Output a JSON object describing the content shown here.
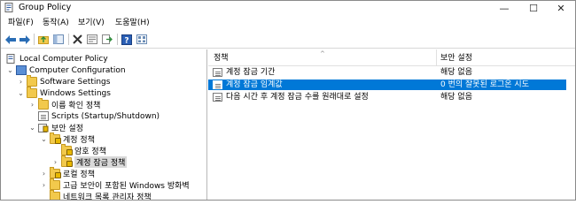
{
  "window": {
    "title": "Group Policy",
    "controls": {
      "minimize": "—",
      "maximize": "☐",
      "close": "✕"
    }
  },
  "menu": [
    "파일(F)",
    "동작(A)",
    "보기(V)",
    "도움말(H)"
  ],
  "toolbar": {
    "icons": [
      "back-arrow-icon",
      "forward-arrow-icon",
      "up-folder-icon",
      "show-hide-tree-icon",
      "delete-icon",
      "properties-icon",
      "export-list-icon",
      "help-icon",
      "view-icon"
    ]
  },
  "tree": {
    "nodes": [
      {
        "label": "Local Computer Policy",
        "icon": "policy-icon",
        "expander": ""
      },
      {
        "label": "Computer Configuration",
        "icon": "computer-icon",
        "expander": "⌄"
      },
      {
        "label": "Software Settings",
        "icon": "folder-icon",
        "expander": "›"
      },
      {
        "label": "Windows Settings",
        "icon": "folder-icon",
        "expander": "⌄"
      },
      {
        "label": "이름 확인 정책",
        "icon": "folder-icon",
        "expander": "›"
      },
      {
        "label": "Scripts (Startup/Shutdown)",
        "icon": "script-icon",
        "expander": ""
      },
      {
        "label": "보안 설정",
        "icon": "security-icon",
        "expander": "⌄"
      },
      {
        "label": "계정 정책",
        "icon": "folder-lock-icon",
        "expander": "⌄"
      },
      {
        "label": "암호 정책",
        "icon": "folder-lock-icon",
        "expander": ""
      },
      {
        "label": "계정 잠금 정책",
        "icon": "folder-lock-icon",
        "expander": "›"
      },
      {
        "label": "로컬 정책",
        "icon": "folder-lock-icon",
        "expander": "›"
      },
      {
        "label": "고급 보안이 포함된 Windows 방화벽",
        "icon": "folder-icon",
        "expander": "›"
      },
      {
        "label": "네트워크 목록 관리자 정책",
        "icon": "folder-icon",
        "expander": ""
      }
    ],
    "selected_index": 9
  },
  "list": {
    "sort_indicator": "^",
    "columns": [
      "정책",
      "보안 설정"
    ],
    "rows": [
      {
        "policy": "계정 잠금 기간",
        "setting": "해당 없음",
        "selected": false
      },
      {
        "policy": "계정 잠금 임계값",
        "setting": "0 번의 잘못된 로그온 시도",
        "selected": true
      },
      {
        "policy": "다음 시간 후 계정 잠금 수를 원래대로 설정",
        "setting": "해당 없음",
        "selected": false
      }
    ]
  },
  "colors": {
    "selection": "#0078d7",
    "tree_selection": "#d9d9d9"
  }
}
